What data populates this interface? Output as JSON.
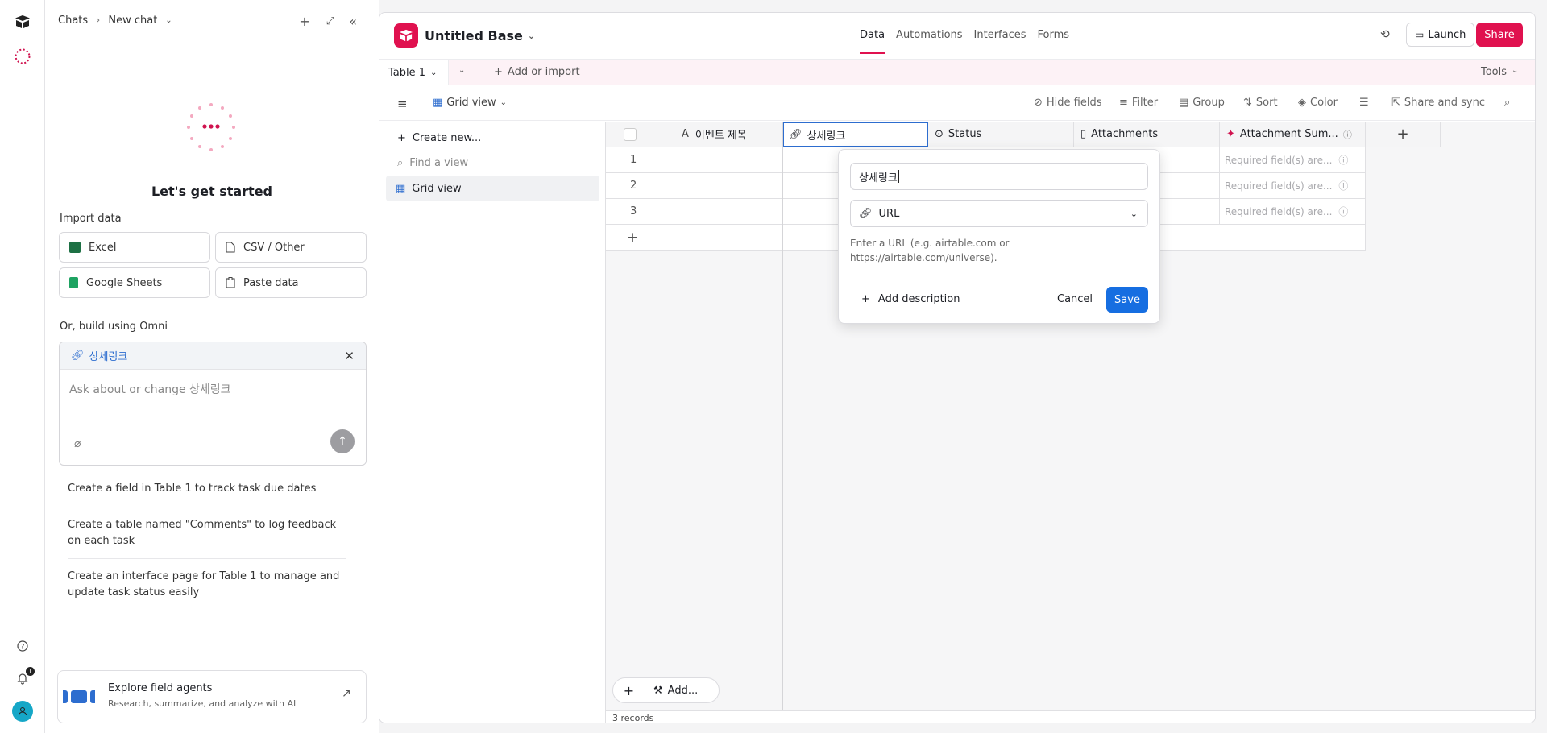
{
  "rail": {
    "icons": [
      "airtable-logo-icon",
      "omni-icon",
      "help-icon",
      "bell-icon",
      "account-icon"
    ],
    "notification_count": "1"
  },
  "chat": {
    "breadcrumb_root": "Chats",
    "breadcrumb_current": "New chat",
    "heading": "Let's get started",
    "import_title": "Import data",
    "import_buttons": [
      "Excel",
      "CSV / Other",
      "Google Sheets",
      "Paste data"
    ],
    "omni_title": "Or, build using Omni",
    "context_tag": "상세링크",
    "input_placeholder": "Ask about or change 상세링크",
    "suggestions": [
      "Create a field in Table 1 to track task due dates",
      "Create a table named \"Comments\" to log feedback on each task",
      "Create an interface page for Table 1 to manage and update task status easily"
    ],
    "agents_title": "Explore field agents",
    "agents_subtitle": "Research, summarize, and analyze with AI"
  },
  "base": {
    "name": "Untitled Base",
    "nav_tabs": [
      "Data",
      "Automations",
      "Interfaces",
      "Forms"
    ],
    "active_tab": "Data",
    "launch_label": "Launch",
    "share_label": "Share",
    "brand_color": "#e0114f"
  },
  "tablebar": {
    "table_name": "Table 1",
    "add_label": "Add or import",
    "tools_label": "Tools"
  },
  "viewbar": {
    "view_name": "Grid view",
    "actions": [
      "Hide fields",
      "Filter",
      "Group",
      "Sort",
      "Color",
      "Share and sync"
    ]
  },
  "sidebar": {
    "create_label": "Create new...",
    "find_placeholder": "Find a view",
    "views": [
      "Grid view"
    ]
  },
  "grid": {
    "columns": [
      "이벤트 제목",
      "상세링크",
      "Status",
      "Attachments",
      "Attachment Sum..."
    ],
    "rows": [
      "1",
      "2",
      "3"
    ],
    "required_text": "Required field(s) are...",
    "record_count": "3 records",
    "add_label": "Add..."
  },
  "popup": {
    "field_name": "상세링크",
    "field_type": "URL",
    "help_text_1": "Enter a URL (e.g. airtable.com or",
    "help_text_2": "https://airtable.com/universe).",
    "add_description": "Add description",
    "cancel": "Cancel",
    "save": "Save"
  }
}
